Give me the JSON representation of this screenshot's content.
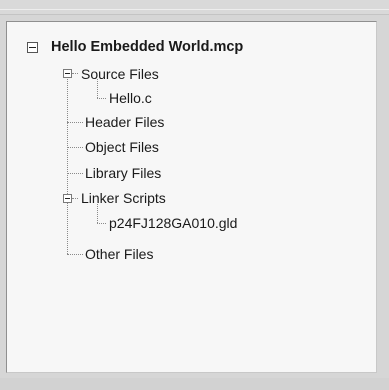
{
  "tree": {
    "root": {
      "label": "Hello Embedded World.mcp",
      "expanded": true
    },
    "nodes": [
      {
        "label": "Source Files",
        "expanded": true,
        "children": [
          {
            "label": "Hello.c"
          }
        ]
      },
      {
        "label": "Header Files"
      },
      {
        "label": "Object Files"
      },
      {
        "label": "Library Files"
      },
      {
        "label": "Linker Scripts",
        "expanded": true,
        "children": [
          {
            "label": "p24FJ128GA010.gld"
          }
        ]
      },
      {
        "label": "Other Files"
      }
    ]
  },
  "icons": {
    "expanded": "minus-box-icon"
  }
}
